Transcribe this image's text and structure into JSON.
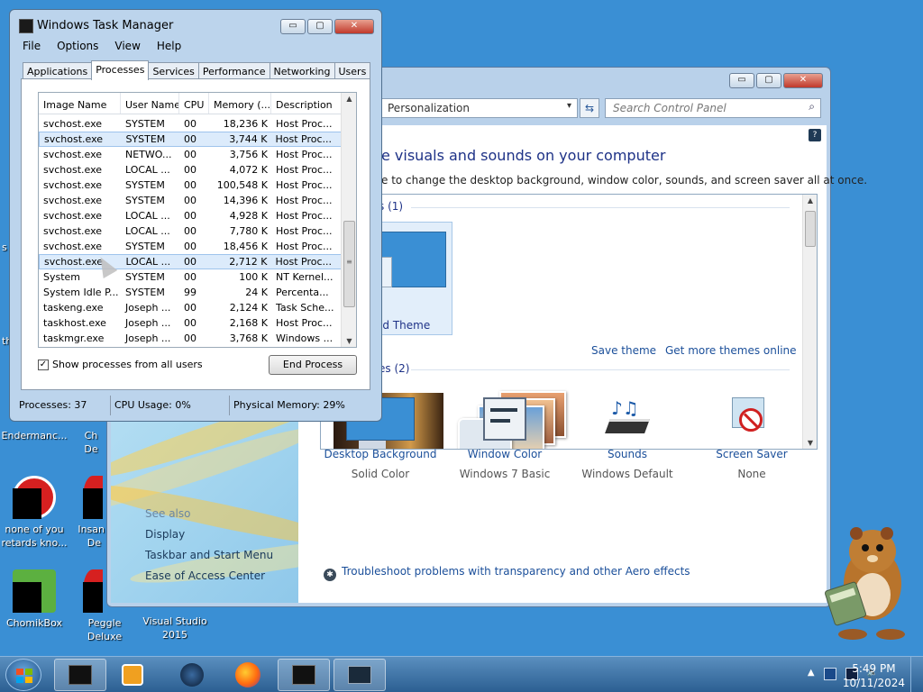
{
  "desktop": {
    "icons": [
      {
        "label": "Endermanc...",
        "extra": ""
      },
      {
        "label": "none of you",
        "extra": "retards kno..."
      },
      {
        "label": "ChomikBox",
        "extra": ""
      },
      {
        "label": "Peggle Deluxe",
        "extra": ""
      },
      {
        "label": "Visual Studio",
        "extra": "2015"
      },
      {
        "label": "Insan",
        "extra": "De"
      },
      {
        "label": "Ch",
        "extra": "De"
      }
    ],
    "edge_text": [
      "s",
      "th"
    ]
  },
  "control_panel": {
    "address": "Personalization",
    "search_placeholder": "Search Control Panel",
    "help": "?",
    "heading": "e visuals and sounds on your computer",
    "subheading": "e to change the desktop background, window color, sounds, and screen saver all at once.",
    "group1_label": "s (1)",
    "theme_name": "ed Theme",
    "save_theme": "Save theme",
    "get_more": "Get more themes online",
    "group2_label": "es (2)",
    "see_also": {
      "header": "See also",
      "items": [
        "Display",
        "Taskbar and Start Menu",
        "Ease of Access Center"
      ]
    },
    "settings": [
      {
        "title": "Desktop Background",
        "value": "Solid Color"
      },
      {
        "title": "Window Color",
        "value": "Windows 7 Basic"
      },
      {
        "title": "Sounds",
        "value": "Windows Default"
      },
      {
        "title": "Screen Saver",
        "value": "None"
      }
    ],
    "troubleshoot": "Troubleshoot problems with transparency and other Aero effects",
    "window_buttons": {
      "minimize": "▭",
      "maximize": "▢",
      "close": "✕"
    }
  },
  "task_manager": {
    "title": "Windows Task Manager",
    "menu": [
      "File",
      "Options",
      "View",
      "Help"
    ],
    "tabs": [
      "Applications",
      "Processes",
      "Services",
      "Performance",
      "Networking",
      "Users"
    ],
    "active_tab": "Processes",
    "columns": [
      "Image Name",
      "User Name",
      "CPU",
      "Memory (...",
      "Description"
    ],
    "rows": [
      [
        "svchost.exe",
        "SYSTEM",
        "00",
        "18,236 K",
        "Host Proc..."
      ],
      [
        "svchost.exe",
        "SYSTEM",
        "00",
        "3,744 K",
        "Host Proc..."
      ],
      [
        "svchost.exe",
        "NETWO...",
        "00",
        "3,756 K",
        "Host Proc..."
      ],
      [
        "svchost.exe",
        "LOCAL ...",
        "00",
        "4,072 K",
        "Host Proc..."
      ],
      [
        "svchost.exe",
        "SYSTEM",
        "00",
        "100,548 K",
        "Host Proc..."
      ],
      [
        "svchost.exe",
        "SYSTEM",
        "00",
        "14,396 K",
        "Host Proc..."
      ],
      [
        "svchost.exe",
        "LOCAL ...",
        "00",
        "4,928 K",
        "Host Proc..."
      ],
      [
        "svchost.exe",
        "LOCAL ...",
        "00",
        "7,780 K",
        "Host Proc..."
      ],
      [
        "svchost.exe",
        "SYSTEM",
        "00",
        "18,456 K",
        "Host Proc..."
      ],
      [
        "svchost.exe",
        "LOCAL ...",
        "00",
        "2,712 K",
        "Host Proc..."
      ],
      [
        "System",
        "SYSTEM",
        "00",
        "100 K",
        "NT Kernel..."
      ],
      [
        "System Idle P...",
        "SYSTEM",
        "99",
        "24 K",
        "Percenta..."
      ],
      [
        "taskeng.exe",
        "Joseph ...",
        "00",
        "2,124 K",
        "Task Sche..."
      ],
      [
        "taskhost.exe",
        "Joseph ...",
        "00",
        "2,168 K",
        "Host Proc..."
      ],
      [
        "taskmgr.exe",
        "Joseph ...",
        "00",
        "3,768 K",
        "Windows ..."
      ]
    ],
    "show_all_users": "Show processes from all users",
    "end_process": "End Process",
    "status": {
      "processes": "Processes: 37",
      "cpu": "CPU Usage: 0%",
      "memory": "Physical Memory: 29%"
    },
    "window_buttons": {
      "minimize": "▭",
      "maximize": "▢",
      "close": "✕"
    }
  },
  "taskbar": {
    "time": "5:49 PM",
    "date": "10/11/2024"
  }
}
